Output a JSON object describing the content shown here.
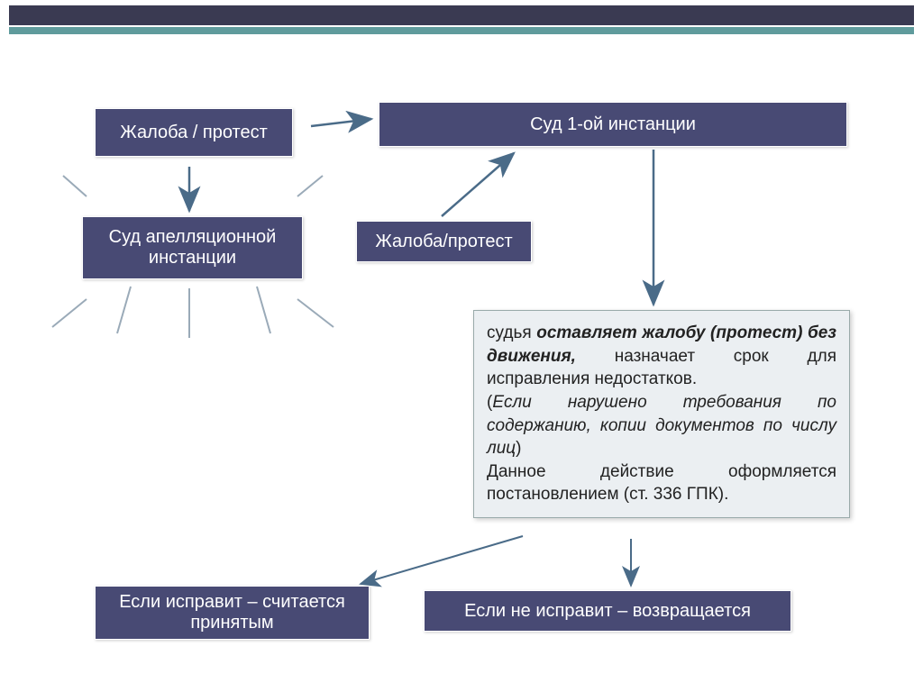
{
  "boxes": {
    "complaint_protest_top": "Жалоба / протест",
    "court_first_instance": "Суд 1-ой инстанции",
    "court_appeal": "Суд апелляционной\nинстанции",
    "complaint_protest_mid": "Жалоба/протест",
    "if_fixed": "Если исправит – считается\nпринятым",
    "if_not_fixed": "Если не исправит – возвращается"
  },
  "info": {
    "line1_a": "судья ",
    "line1_b": "оставляет жалобу (протест) без движения,",
    "line1_c": " назначает срок для исправления недостатков.",
    "line2_a": "(",
    "line2_b": "Если нарушено требования по содержанию, копии документов по числу лиц",
    "line2_c": ")",
    "line3": "Данное действие оформляется постановлением (ст. 336 ГПК)."
  }
}
